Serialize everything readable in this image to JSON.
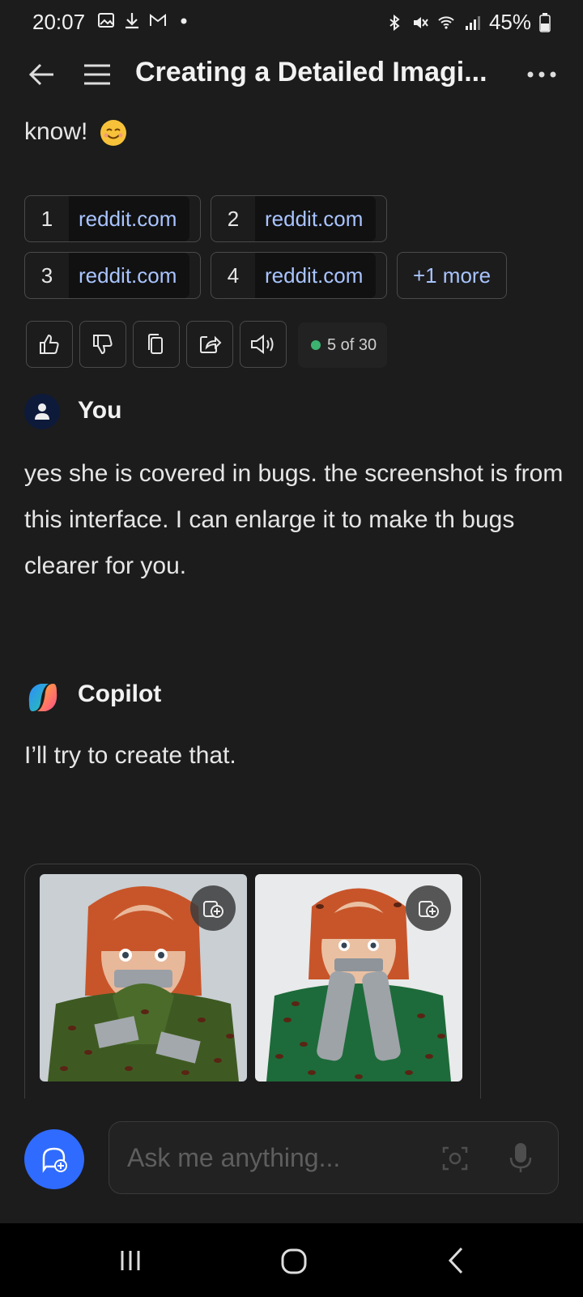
{
  "status_bar": {
    "time": "20:07",
    "battery": "45%",
    "left_icons": [
      "gallery-icon",
      "download-icon",
      "gmail-icon",
      "dot-icon"
    ],
    "right_icons": [
      "bluetooth-icon",
      "mute-icon",
      "wifi-icon",
      "signal-icon",
      "battery-icon"
    ]
  },
  "header": {
    "title": "Creating a Detailed Imagi...",
    "back_icon": "arrow-left-icon",
    "menu_icon": "hamburger-icon",
    "more_icon": "more-horizontal-icon"
  },
  "prev_message": {
    "text": "know!",
    "emoji": "smiling-face-icon"
  },
  "sources": [
    {
      "num": "1",
      "site": "reddit.com"
    },
    {
      "num": "2",
      "site": "reddit.com"
    },
    {
      "num": "3",
      "site": "reddit.com"
    },
    {
      "num": "4",
      "site": "reddit.com"
    }
  ],
  "sources_more": "+1 more",
  "actions": [
    "thumbs-up-icon",
    "thumbs-down-icon",
    "copy-icon",
    "share-icon",
    "speaker-icon"
  ],
  "counter": {
    "text": "5 of 30",
    "dot_color": "#3cb371"
  },
  "user": {
    "label": "You",
    "message": "yes she is covered in bugs. the screenshot is from this interface. I can enlarge it to make th bugs clearer for you."
  },
  "copilot": {
    "label": "Copilot",
    "message": "I’ll try to create that."
  },
  "images": [
    {
      "icon": "add-to-collection-icon"
    },
    {
      "icon": "add-to-collection-icon"
    }
  ],
  "composer": {
    "placeholder": "Ask me anything...",
    "camera_icon": "camera-scan-icon",
    "mic_icon": "microphone-icon",
    "new_chat_icon": "new-chat-icon"
  },
  "nav": [
    "recent-apps-icon",
    "home-icon",
    "back-icon"
  ],
  "colors": {
    "background": "#1c1c1c",
    "link": "#a9c4ff",
    "accent": "#2f6bff"
  }
}
